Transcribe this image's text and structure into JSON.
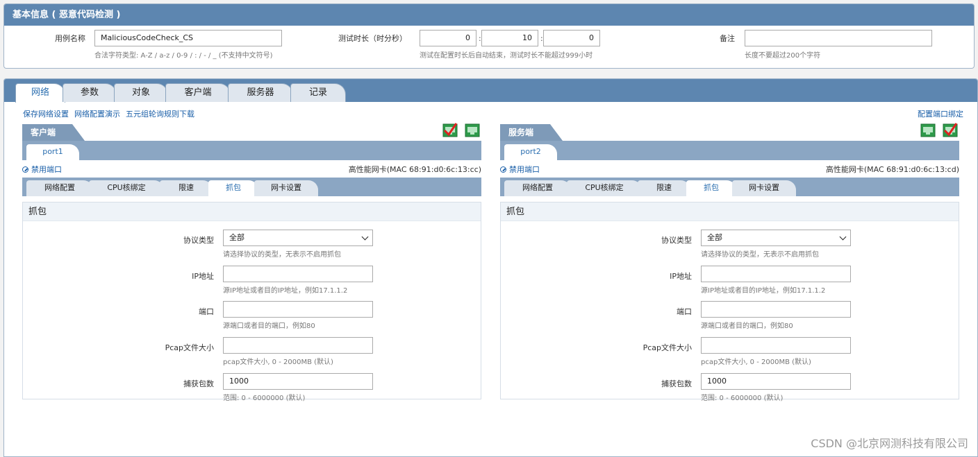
{
  "basic_info": {
    "title": "基本信息 ( 恶意代码检测 )",
    "case_name_label": "用例名称",
    "case_name_value": "MaliciousCodeCheck_CS",
    "case_name_hint": "合法字符类型: A-Z / a-z / 0-9 / : / - / _ (不支持中文符号)",
    "duration_label": "测试时长（时分秒）",
    "duration_hours": "0",
    "duration_minutes": "10",
    "duration_seconds": "0",
    "duration_hint": "测试在配置时长后自动结束，测试时长不能超过999小时",
    "remark_label": "备注",
    "remark_value": "",
    "remark_hint": "长度不要超过200个字符"
  },
  "main_tabs": [
    {
      "label": "网络",
      "active": true
    },
    {
      "label": "参数",
      "active": false
    },
    {
      "label": "对象",
      "active": false
    },
    {
      "label": "客户端",
      "active": false
    },
    {
      "label": "服务器",
      "active": false
    },
    {
      "label": "记录",
      "active": false
    }
  ],
  "network_links": [
    "保存网络设置",
    "网络配置演示",
    "五元组轮询规则下载"
  ],
  "port_binding_link": "配置端口绑定",
  "sides": [
    {
      "title": "客户端",
      "port": "port1",
      "disable_label": "禁用端口",
      "nic_info": "高性能网卡(MAC 68:91:d0:6c:13:cc)",
      "icons": [
        "network-check-icon",
        "network-icon"
      ],
      "sub_tabs": [
        {
          "label": "网络配置",
          "active": false
        },
        {
          "label": "CPU核绑定",
          "active": false
        },
        {
          "label": "限速",
          "active": false
        },
        {
          "label": "抓包",
          "active": true
        },
        {
          "label": "网卡设置",
          "active": false
        }
      ],
      "capture": {
        "heading": "抓包",
        "fields": [
          {
            "label": "协议类型",
            "value": "全部",
            "hint": "请选择协议的类型，无表示不启用抓包",
            "type": "select"
          },
          {
            "label": "IP地址",
            "value": "",
            "hint": "源IP地址或者目的IP地址，例如17.1.1.2",
            "type": "text"
          },
          {
            "label": "端口",
            "value": "",
            "hint": "源端口或者目的端口，例如80",
            "type": "text"
          },
          {
            "label": "Pcap文件大小",
            "value": "",
            "hint": "pcap文件大小, 0 - 2000MB (默认)",
            "type": "text"
          },
          {
            "label": "捕获包数",
            "value": "1000",
            "hint": "范围: 0 - 6000000 (默认)",
            "type": "text"
          }
        ]
      }
    },
    {
      "title": "服务端",
      "port": "port2",
      "disable_label": "禁用端口",
      "nic_info": "高性能网卡(MAC 68:91:d0:6c:13:cd)",
      "icons": [
        "network-icon",
        "network-check-icon"
      ],
      "sub_tabs": [
        {
          "label": "网络配置",
          "active": false
        },
        {
          "label": "CPU核绑定",
          "active": false
        },
        {
          "label": "限速",
          "active": false
        },
        {
          "label": "抓包",
          "active": true
        },
        {
          "label": "网卡设置",
          "active": false
        }
      ],
      "capture": {
        "heading": "抓包",
        "fields": [
          {
            "label": "协议类型",
            "value": "全部",
            "hint": "请选择协议的类型，无表示不启用抓包",
            "type": "select"
          },
          {
            "label": "IP地址",
            "value": "",
            "hint": "源IP地址或者目的IP地址，例如17.1.1.2",
            "type": "text"
          },
          {
            "label": "端口",
            "value": "",
            "hint": "源端口或者目的端口，例如80",
            "type": "text"
          },
          {
            "label": "Pcap文件大小",
            "value": "",
            "hint": "pcap文件大小, 0 - 2000MB (默认)",
            "type": "text"
          },
          {
            "label": "捕获包数",
            "value": "1000",
            "hint": "范围: 0 - 6000000 (默认)",
            "type": "text"
          }
        ]
      }
    }
  ],
  "watermark": "CSDN @北京网测科技有限公司",
  "colors": {
    "header_blue": "#5d86b0",
    "tab_bar": "#8ba6c3",
    "link_blue": "#1a5fa8",
    "icon_green": "#2e9a4a",
    "check_red": "#e02020"
  }
}
